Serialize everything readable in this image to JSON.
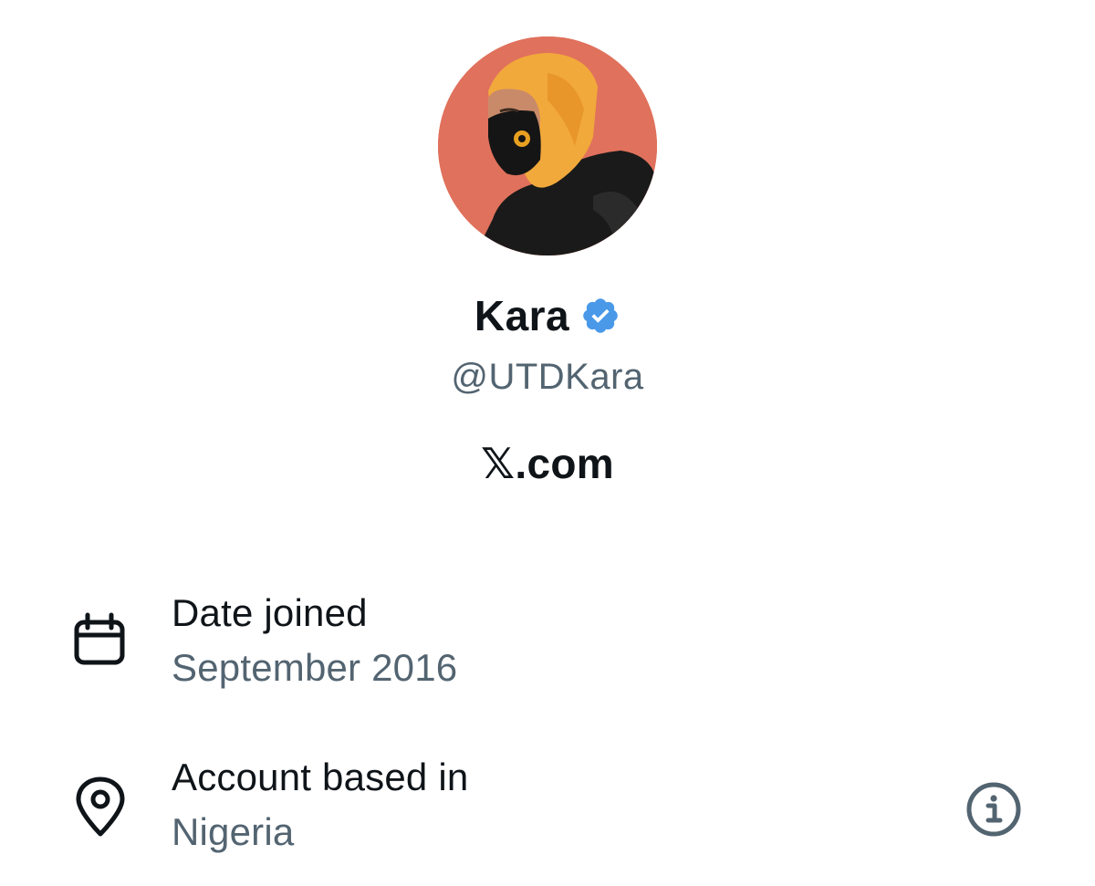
{
  "profile": {
    "display_name": "Kara",
    "handle": "@UTDKara",
    "verified_icon": "verified-badge-icon",
    "verified_color": "#4a99e9"
  },
  "brand": {
    "text": "𝕏.com"
  },
  "about": {
    "date_joined": {
      "icon": "calendar-icon",
      "label": "Date joined",
      "value": "September 2016"
    },
    "account_based_in": {
      "icon": "location-pin-icon",
      "label": "Account based in",
      "value": "Nigeria",
      "action_icon": "info-icon"
    }
  },
  "colors": {
    "primary_text": "#0f1419",
    "secondary_text": "#536471",
    "avatar_background": "#e0715c",
    "hood": "#f2a93b"
  }
}
